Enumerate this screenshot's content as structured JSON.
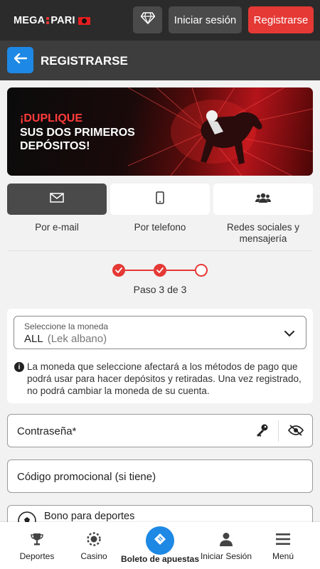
{
  "header": {
    "logo_text_left": "MEGA",
    "logo_text_right": "PARI",
    "login_label": "Iniciar sesión",
    "register_label": "Registrarse",
    "gem_icon": "diamond-icon"
  },
  "titlebar": {
    "title": "REGISTRARSE",
    "back_icon": "arrow-left-icon"
  },
  "banner": {
    "line1": "¡DUPLIQUE",
    "line2": "SUS DOS PRIMEROS DEPÓSITOS!"
  },
  "methods": [
    {
      "label": "Por e-mail",
      "icon": "envelope-icon",
      "active": true
    },
    {
      "label": "Por telefono",
      "icon": "phone-icon",
      "active": false
    },
    {
      "label": "Redes sociales y mensajería",
      "icon": "users-icon",
      "active": false
    }
  ],
  "stepper": {
    "text": "Paso 3 de 3",
    "total": 3,
    "completed": 2
  },
  "currency": {
    "label": "Seleccione la moneda",
    "value": "ALL",
    "value_detail": "(Lek albano)",
    "info": "La moneda que seleccione afectará a los métodos de pago que podrá usar para hacer depósitos y retiradas. Una vez registrado, no podrá cambiar la moneda de su cuenta."
  },
  "password": {
    "placeholder": "Contraseña*"
  },
  "promo": {
    "placeholder": "Código promocional (si tiene)"
  },
  "bonus": {
    "label": "Bono para deportes"
  },
  "colors": {
    "accent_red": "#e53935",
    "accent_blue": "#1e88e5",
    "dark_bg": "#2b2b2b"
  },
  "bottom_nav": {
    "sports": "Deportes",
    "casino": "Casino",
    "betslip": "Boleto de apuestas",
    "login": "Iniciar Sesión",
    "menu": "Menú"
  }
}
